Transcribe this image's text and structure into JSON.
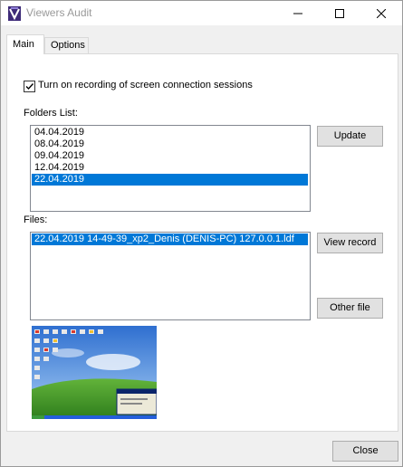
{
  "window": {
    "title": "Viewers Audit"
  },
  "tabs": [
    {
      "label": "Main",
      "active": true
    },
    {
      "label": "Options",
      "active": false
    }
  ],
  "recording": {
    "checkbox_label": "Turn on recording of screen connection sessions",
    "checked": true
  },
  "folders": {
    "label": "Folders List:",
    "items": [
      "04.04.2019",
      "08.04.2019",
      "09.04.2019",
      "12.04.2019",
      "22.04.2019"
    ],
    "selected": "22.04.2019"
  },
  "files": {
    "label": "Files:",
    "items": [
      "22.04.2019 14-49-39_xp2_Denis (DENIS-PC) 127.0.0.1.ldf"
    ],
    "selected": "22.04.2019 14-49-39_xp2_Denis (DENIS-PC) 127.0.0.1.ldf"
  },
  "buttons": {
    "update": "Update",
    "view_record": "View record",
    "other_file": "Other file",
    "close": "Close"
  },
  "preview": {
    "description_icon": "desktop-screenshot-thumbnail"
  },
  "colors": {
    "selection": "#0078d7",
    "window_bg": "#f0f0f0",
    "title_text": "#999999"
  }
}
